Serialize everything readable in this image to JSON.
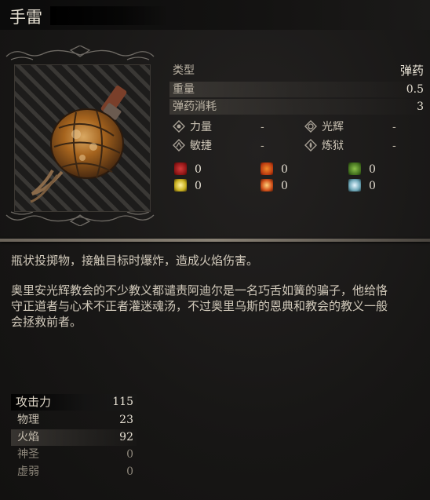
{
  "item": {
    "name": "手雷"
  },
  "props": {
    "type_label": "类型",
    "type_value": "弹药",
    "weight_label": "重量",
    "weight_value": "0.5",
    "ammo_label": "弹药消耗",
    "ammo_value": "3"
  },
  "requirements": [
    {
      "label": "力量",
      "value": "-",
      "icon": "strength-icon"
    },
    {
      "label": "光辉",
      "value": "-",
      "icon": "radiance-icon"
    },
    {
      "label": "敏捷",
      "value": "-",
      "icon": "agility-icon"
    },
    {
      "label": "炼狱",
      "value": "-",
      "icon": "inferno-icon"
    }
  ],
  "resistances": [
    {
      "value": "0",
      "icon": "bleed-icon",
      "color": "#8a1414"
    },
    {
      "value": "0",
      "icon": "fire-icon",
      "color": "#b8380f"
    },
    {
      "value": "0",
      "icon": "poison-icon",
      "color": "#3f6b1c"
    },
    {
      "value": "0",
      "icon": "lightning-icon",
      "color": "#c9b020"
    },
    {
      "value": "0",
      "icon": "burn-icon",
      "color": "#d0501a"
    },
    {
      "value": "0",
      "icon": "frost-icon",
      "color": "#6fa7b8"
    }
  ],
  "description": {
    "line1": "瓶状投掷物，接触目标时爆炸，造成火焰伤害。",
    "lore_line1": "奥里安光辉教会的不少教义都谴责阿迪尔是一名巧舌如簧的骗子，他给恪",
    "lore_line2": "守正道者与心术不正者灌迷魂汤，不过奥里乌斯的恩典和教会的教义一般",
    "lore_line3": "会拯救前者。"
  },
  "attack": {
    "header_label": "攻击力",
    "header_value": "115",
    "rows": [
      {
        "label": "物理",
        "value": "23"
      },
      {
        "label": "火焰",
        "value": "92"
      },
      {
        "label": "神圣",
        "value": "0"
      },
      {
        "label": "虚弱",
        "value": "0"
      }
    ]
  },
  "colors": {
    "accent": "#e8e2d4",
    "divider": "#8a8275",
    "background": "#171615"
  }
}
